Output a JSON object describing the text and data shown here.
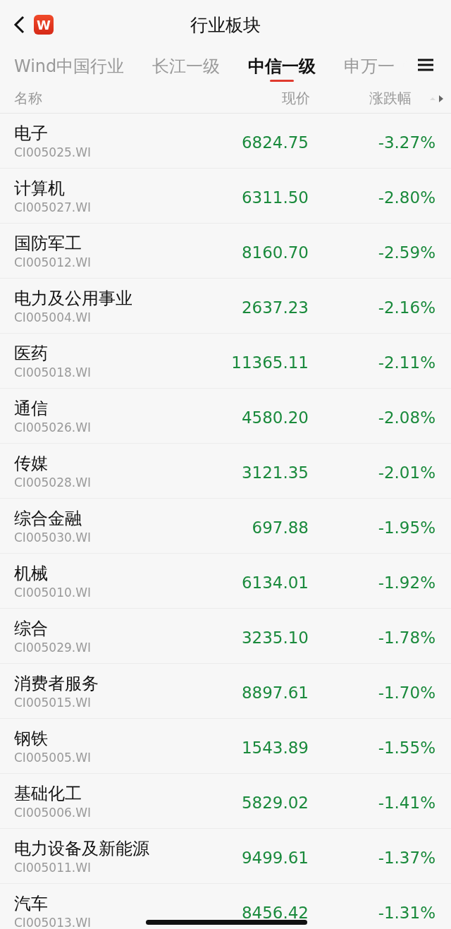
{
  "header": {
    "title": "行业板块",
    "logo": "W"
  },
  "tabs": [
    {
      "label": "Wind中国行业",
      "selected": false
    },
    {
      "label": "长江一级",
      "selected": false
    },
    {
      "label": "中信一级",
      "selected": true
    },
    {
      "label": "申万一",
      "selected": false
    }
  ],
  "table": {
    "columns": [
      "名称",
      "现价",
      "涨跌幅"
    ],
    "rows": [
      {
        "name": "电子",
        "code": "CI005025.WI",
        "price": "6824.75",
        "change": "-3.27%"
      },
      {
        "name": "计算机",
        "code": "CI005027.WI",
        "price": "6311.50",
        "change": "-2.80%"
      },
      {
        "name": "国防军工",
        "code": "CI005012.WI",
        "price": "8160.70",
        "change": "-2.59%"
      },
      {
        "name": "电力及公用事业",
        "code": "CI005004.WI",
        "price": "2637.23",
        "change": "-2.16%"
      },
      {
        "name": "医药",
        "code": "CI005018.WI",
        "price": "11365.11",
        "change": "-2.11%"
      },
      {
        "name": "通信",
        "code": "CI005026.WI",
        "price": "4580.20",
        "change": "-2.08%"
      },
      {
        "name": "传媒",
        "code": "CI005028.WI",
        "price": "3121.35",
        "change": "-2.01%"
      },
      {
        "name": "综合金融",
        "code": "CI005030.WI",
        "price": "697.88",
        "change": "-1.95%"
      },
      {
        "name": "机械",
        "code": "CI005010.WI",
        "price": "6134.01",
        "change": "-1.92%"
      },
      {
        "name": "综合",
        "code": "CI005029.WI",
        "price": "3235.10",
        "change": "-1.78%"
      },
      {
        "name": "消费者服务",
        "code": "CI005015.WI",
        "price": "8897.61",
        "change": "-1.70%"
      },
      {
        "name": "钢铁",
        "code": "CI005005.WI",
        "price": "1543.89",
        "change": "-1.55%"
      },
      {
        "name": "基础化工",
        "code": "CI005006.WI",
        "price": "5829.02",
        "change": "-1.41%"
      },
      {
        "name": "电力设备及新能源",
        "code": "CI005011.WI",
        "price": "9499.61",
        "change": "-1.37%"
      },
      {
        "name": "汽车",
        "code": "CI005013.WI",
        "price": "8456.42",
        "change": "-1.31%"
      }
    ]
  }
}
